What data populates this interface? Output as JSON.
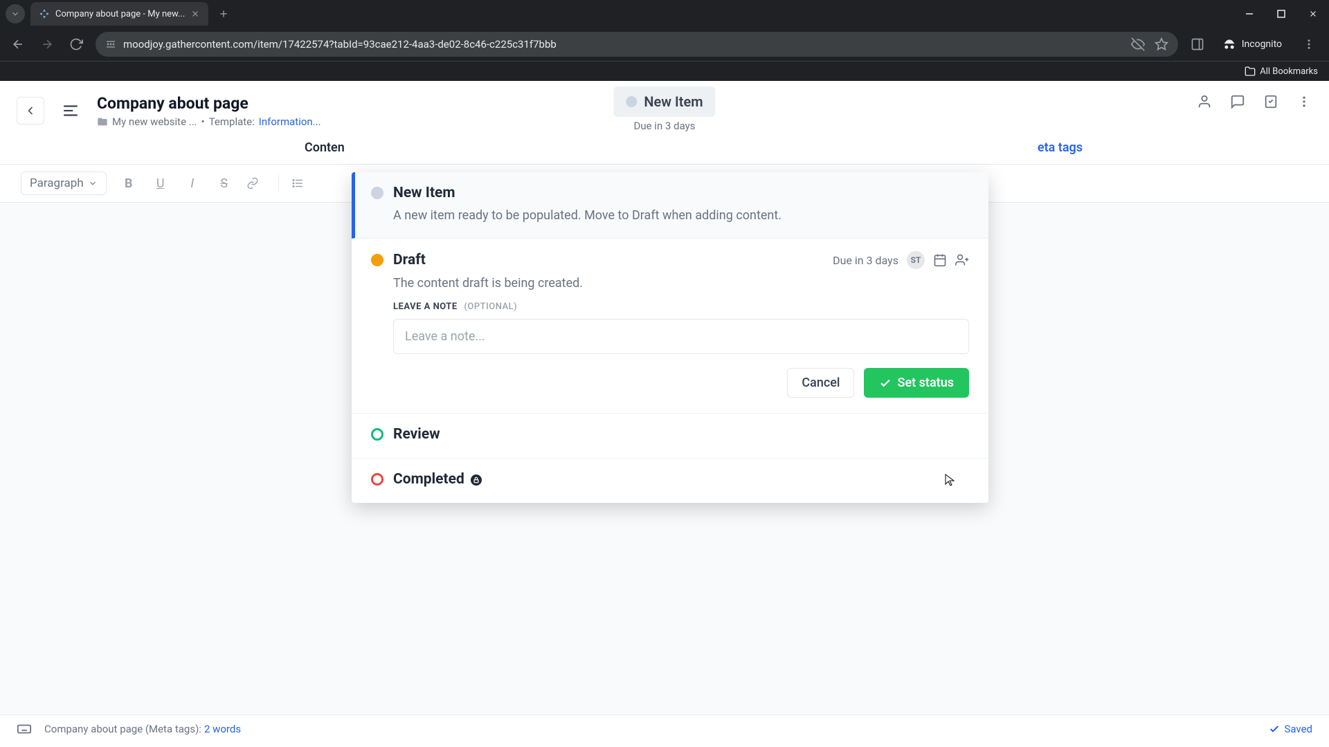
{
  "browser": {
    "tab_title": "Company about page - My new...",
    "url": "moodjoy.gathercontent.com/item/17422574?tabId=93cae212-4aa3-de02-8c46-c225c31f7bbb",
    "incognito_label": "Incognito",
    "all_bookmarks": "All Bookmarks"
  },
  "header": {
    "title": "Company about page",
    "folder": "My new website ...",
    "template_label": "Template:",
    "template_link": "Information...",
    "separator": "•"
  },
  "status_pill": {
    "name": "New Item",
    "due": "Due in 3 days"
  },
  "tabs": {
    "left_partial": "Conten",
    "right_partial": "eta tags"
  },
  "toolbar": {
    "paragraph": "Paragraph"
  },
  "status_dropdown": {
    "new_item": {
      "name": "New Item",
      "desc": "A new item ready to be populated. Move to Draft when adding content."
    },
    "draft": {
      "name": "Draft",
      "due": "Due in 3 days",
      "assignee": "ST",
      "desc": "The content draft is being created.",
      "note_label": "LEAVE A NOTE",
      "note_optional": "(OPTIONAL)",
      "note_placeholder": "Leave a note...",
      "cancel": "Cancel",
      "set_status": "Set status"
    },
    "review": {
      "name": "Review"
    },
    "completed": {
      "name": "Completed"
    }
  },
  "footer": {
    "context": "Company about page (Meta tags):",
    "words": "2 words",
    "saved": "Saved"
  }
}
